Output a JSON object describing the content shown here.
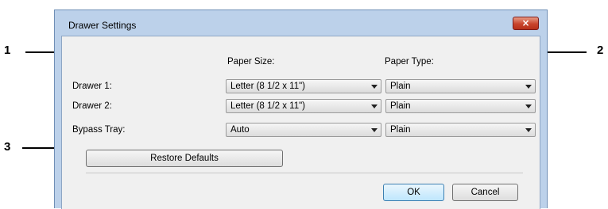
{
  "callouts": {
    "one": "1",
    "two": "2",
    "three": "3"
  },
  "dialog": {
    "title": "Drawer Settings",
    "close_icon": "×",
    "headers": {
      "paper_size": "Paper Size:",
      "paper_type": "Paper Type:"
    },
    "rows": [
      {
        "label": "Drawer 1:",
        "paper_size": "Letter (8 1/2 x 11\")",
        "paper_type": "Plain"
      },
      {
        "label": "Drawer 2:",
        "paper_size": "Letter (8 1/2 x 11\")",
        "paper_type": "Plain"
      },
      {
        "label": "Bypass Tray:",
        "paper_size": "Auto",
        "paper_type": "Plain"
      }
    ],
    "restore_defaults": "Restore Defaults",
    "ok": "OK",
    "cancel": "Cancel"
  },
  "icons": {
    "close": "close-icon",
    "dropdown": "chevron-down-icon"
  },
  "colors": {
    "frame": "#bcd1ea",
    "close_button": "#c8442c",
    "client": "#f0f0f0"
  }
}
